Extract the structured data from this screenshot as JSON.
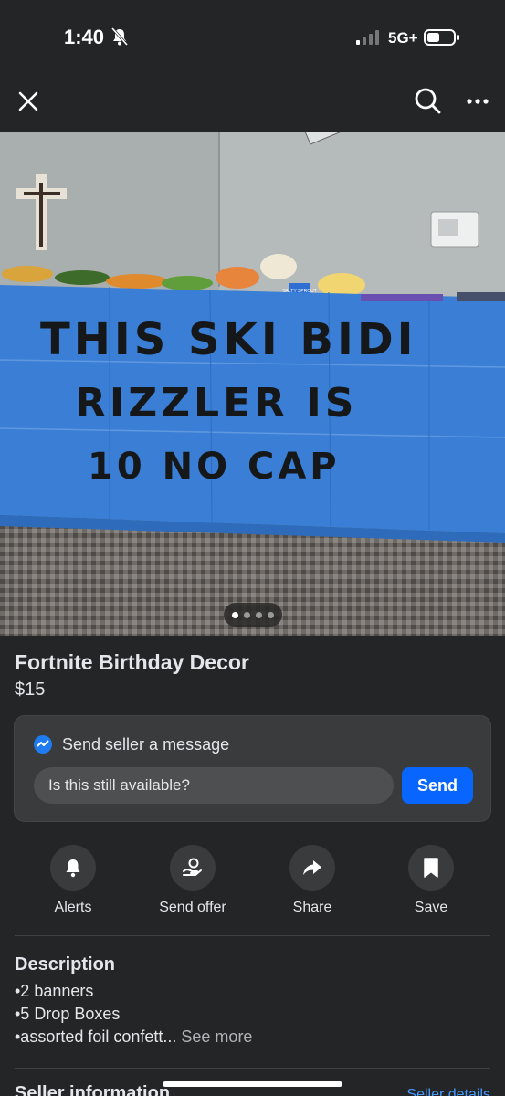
{
  "status_bar": {
    "time": "1:40",
    "network": "5G+"
  },
  "listing": {
    "title": "Fortnite Birthday Decor",
    "price": "$15",
    "photo_count": 4,
    "active_photo": 1
  },
  "photo": {
    "banner_lines": [
      "THIS SKI BIDI",
      "RIZZLER IS",
      "10 NO CAP"
    ],
    "sign_text": "SALTY SPROUT"
  },
  "message": {
    "header": "Send seller a message",
    "input_value": "Is this still available?",
    "send_label": "Send"
  },
  "actions": [
    {
      "label": "Alerts",
      "icon": "bell-icon"
    },
    {
      "label": "Send offer",
      "icon": "offer-icon"
    },
    {
      "label": "Share",
      "icon": "share-icon"
    },
    {
      "label": "Save",
      "icon": "bookmark-icon"
    }
  ],
  "description": {
    "title": "Description",
    "lines": [
      "•2 banners",
      "•5 Drop Boxes",
      "•assorted foil confett..."
    ],
    "see_more": "See more"
  },
  "seller": {
    "title": "Seller information",
    "link": "Seller details"
  },
  "colors": {
    "background": "#242526",
    "card": "#3a3b3c",
    "accent": "#0866ff",
    "tablecloth": "#3a7fd5"
  }
}
